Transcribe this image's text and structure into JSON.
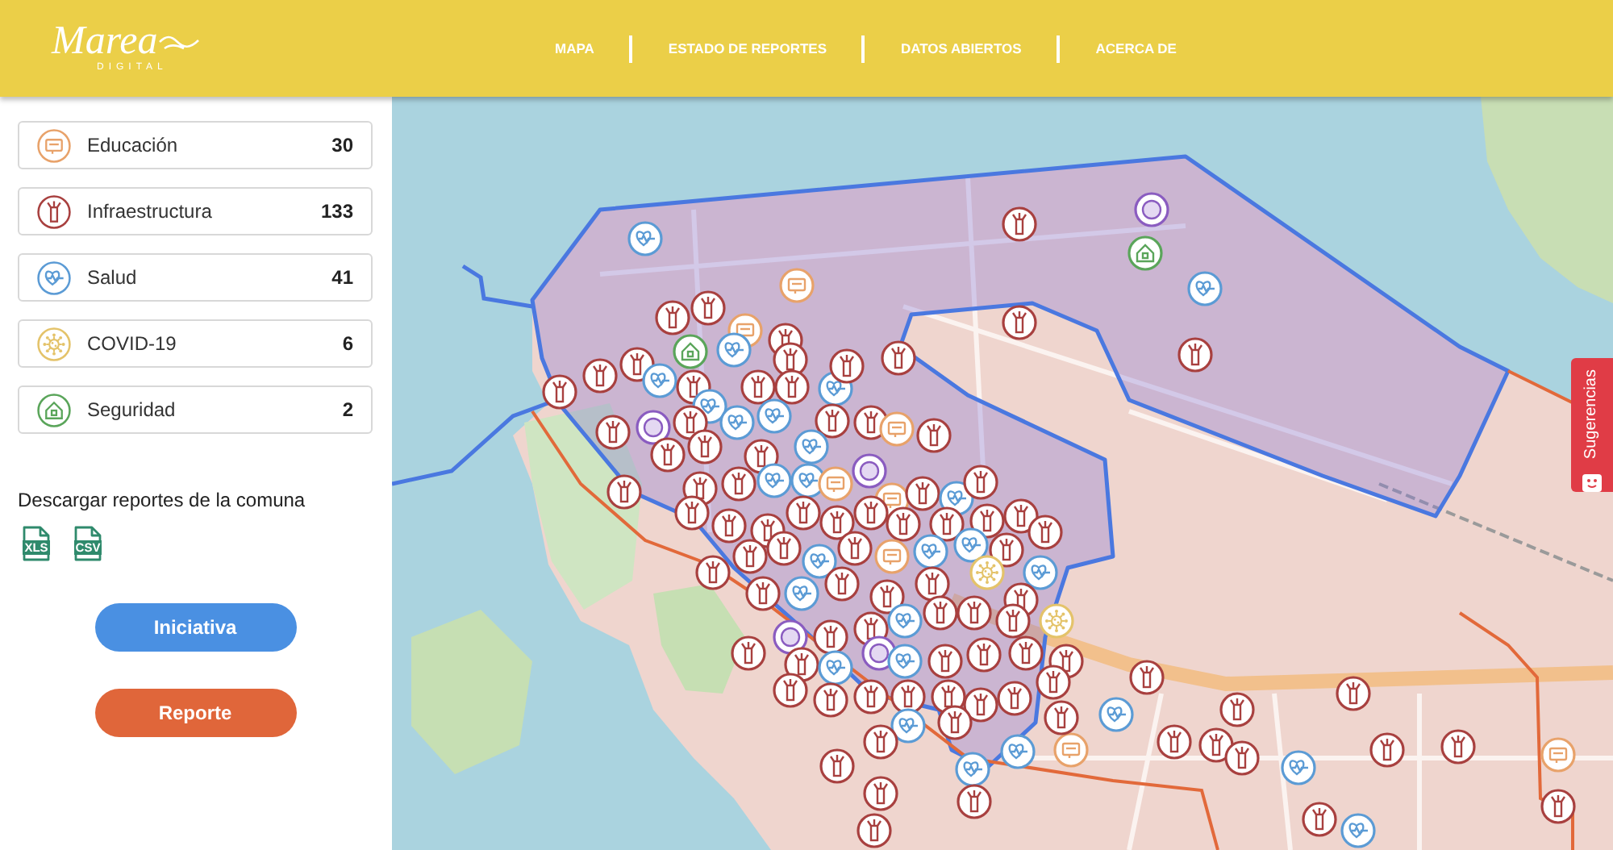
{
  "header": {
    "logo": {
      "title": "Marea",
      "subtitle": "DIGITAL"
    },
    "nav": [
      {
        "label": "MAPA"
      },
      {
        "label": "ESTADO DE REPORTES"
      },
      {
        "label": "DATOS ABIERTOS"
      },
      {
        "label": "ACERCA DE"
      }
    ]
  },
  "sidebar": {
    "categories": [
      {
        "kind": "education",
        "label": "Educación",
        "count": "30",
        "color": "#e8a26a"
      },
      {
        "kind": "infrastructure",
        "label": "Infraestructura",
        "count": "133",
        "color": "#a8403f"
      },
      {
        "kind": "health",
        "label": "Salud",
        "count": "41",
        "color": "#5b9bd5"
      },
      {
        "kind": "covid",
        "label": "COVID-19",
        "count": "6",
        "color": "#e4c36a"
      },
      {
        "kind": "security",
        "label": "Seguridad",
        "count": "2",
        "color": "#5aa55a"
      }
    ],
    "download": {
      "title": "Descargar reportes de la comuna",
      "files": [
        {
          "label": "XLS"
        },
        {
          "label": "CSV"
        }
      ]
    },
    "buttons": [
      {
        "kind": "initiative",
        "label": "Iniciativa"
      },
      {
        "kind": "report",
        "label": "Reporte"
      }
    ]
  },
  "map": {
    "feedback_tab": {
      "label": "Sugerencias"
    }
  }
}
